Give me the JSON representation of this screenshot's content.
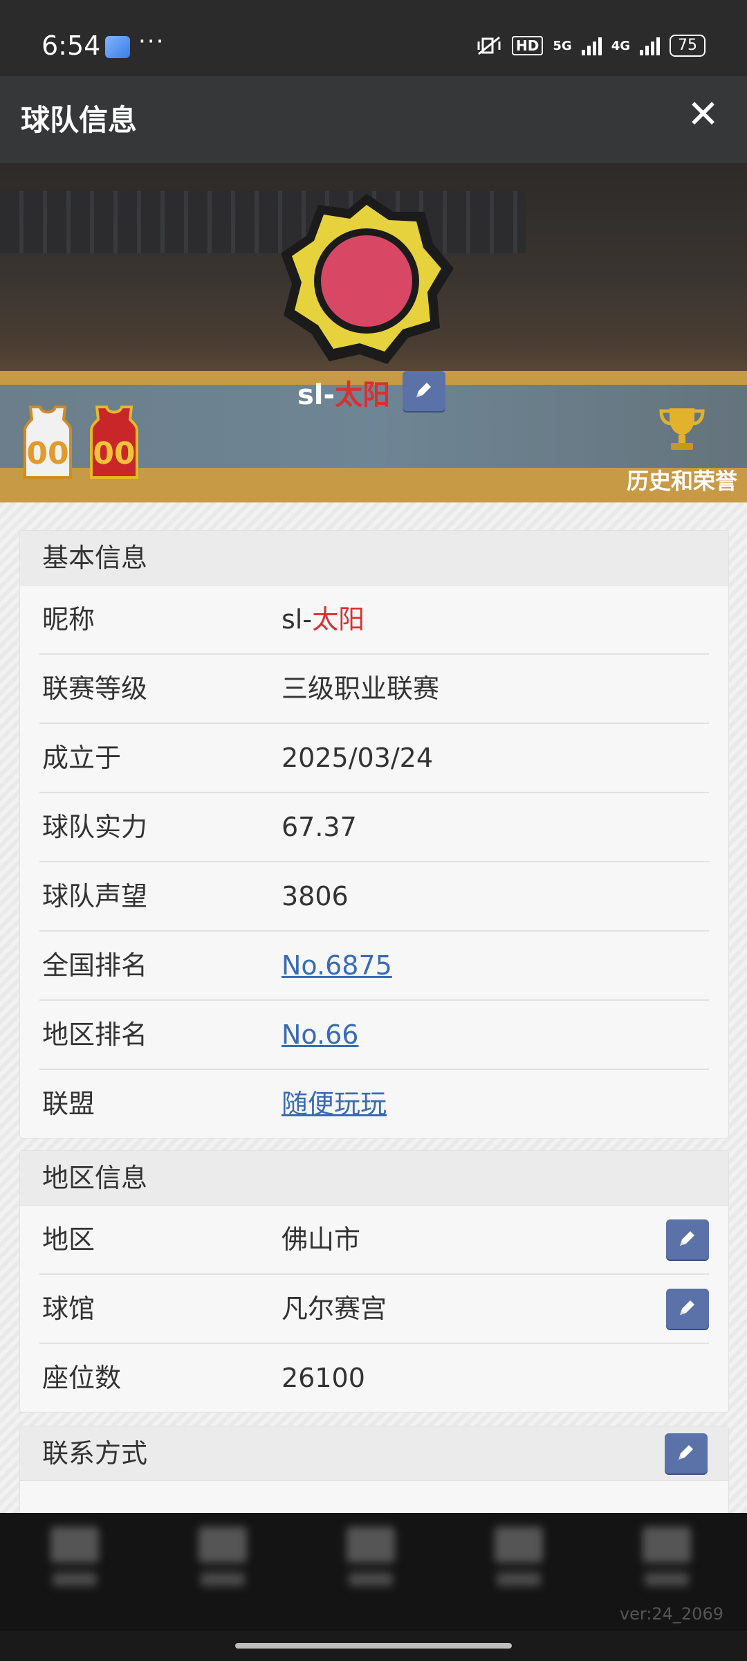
{
  "status_bar": {
    "time": "6:54",
    "more": "···",
    "hd": "HD",
    "net5g": "5G",
    "net4g": "4G",
    "battery": "75"
  },
  "header": {
    "title": "球队信息",
    "close": "✕"
  },
  "team": {
    "name_prefix": "sl-",
    "name_suffix": "太阳",
    "honor_label": "历史和荣誉",
    "jersey_number": "00"
  },
  "basic_info": {
    "title": "基本信息",
    "rows": [
      {
        "label": "昵称",
        "value_prefix": "sl-",
        "value_suffix": "太阳"
      },
      {
        "label": "联赛等级",
        "value": "三级职业联赛"
      },
      {
        "label": "成立于",
        "value": "2025/03/24"
      },
      {
        "label": "球队实力",
        "value": "67.37"
      },
      {
        "label": "球队声望",
        "value": "3806"
      },
      {
        "label": "全国排名",
        "value": "No.6875"
      },
      {
        "label": "地区排名",
        "value": "No.66"
      },
      {
        "label": "联盟",
        "value": "随便玩玩"
      }
    ]
  },
  "region_info": {
    "title": "地区信息",
    "rows": [
      {
        "label": "地区",
        "value": "佛山市"
      },
      {
        "label": "球馆",
        "value": "凡尔赛宫"
      },
      {
        "label": "座位数",
        "value": "26100"
      }
    ]
  },
  "contact": {
    "title": "联系方式"
  },
  "footer": {
    "version": "ver:24_2069"
  },
  "colors": {
    "accent_link": "#3a6bb5",
    "team_red": "#d93030",
    "edit_button": "#5a72a8"
  }
}
